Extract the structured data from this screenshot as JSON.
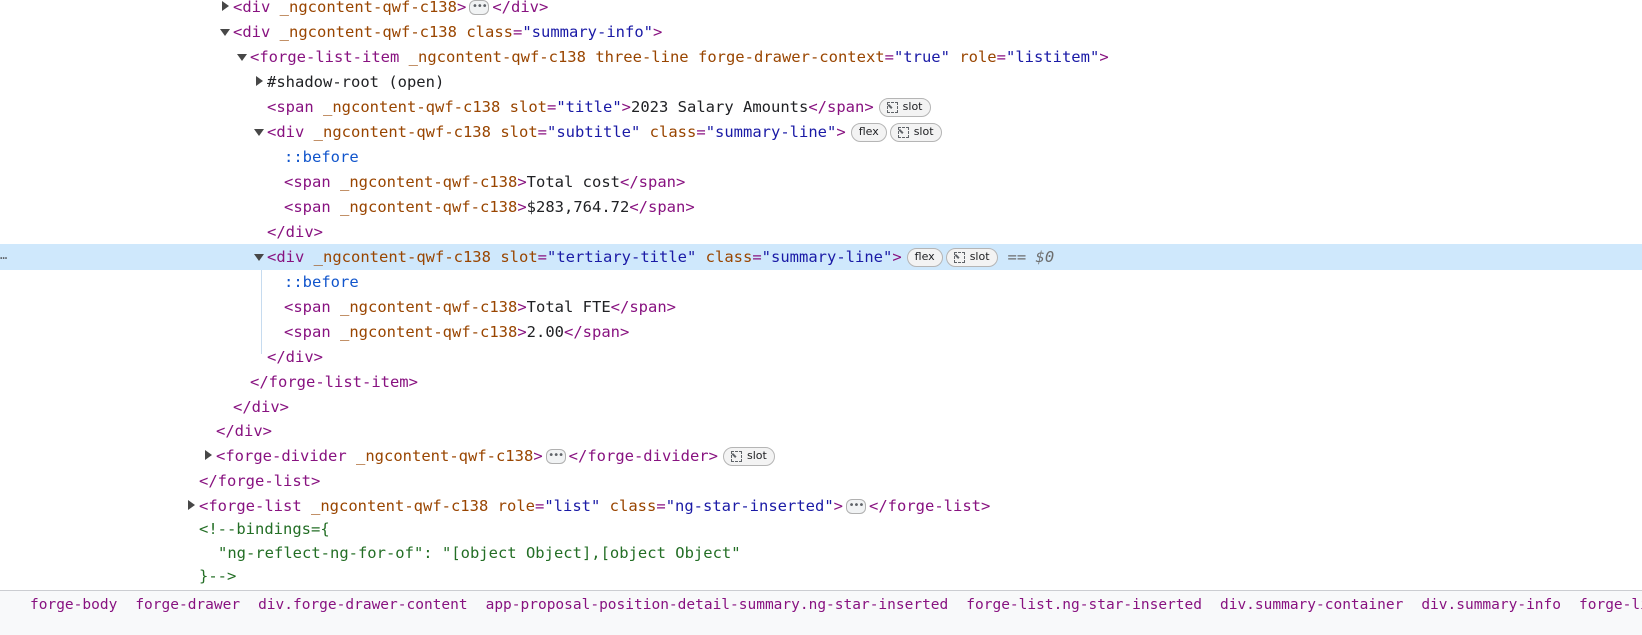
{
  "tree": {
    "r0": {
      "open": "<div",
      "a1": "_ngcontent-qwf-c138",
      "close": ">",
      "endtag": "</div>"
    },
    "r1": {
      "open": "<div",
      "a1": "_ngcontent-qwf-c138",
      "attr": "class",
      "eq": "=",
      "val": "\"summary-info\"",
      "close": ">"
    },
    "r2": {
      "open": "<forge-list-item",
      "a1": "_ngcontent-qwf-c138",
      "a2": "three-line",
      "attr": "forge-drawer-context",
      "eq": "=",
      "val": "\"true\"",
      "attr2": "role",
      "val2": "\"listitem\"",
      "close": ">"
    },
    "r3": {
      "text": "#shadow-root (open)"
    },
    "r4": {
      "open": "<span",
      "a1": "_ngcontent-qwf-c138",
      "attr": "slot",
      "eq": "=",
      "val": "\"title\"",
      "close": ">",
      "text": "2023 Salary Amounts",
      "endtag": "</span>",
      "badge": "slot"
    },
    "r5": {
      "open": "<div",
      "a1": "_ngcontent-qwf-c138",
      "attr": "slot",
      "eq": "=",
      "val": "\"subtitle\"",
      "attr2": "class",
      "val2": "\"summary-line\"",
      "close": ">",
      "badge1": "flex",
      "badge2": "slot"
    },
    "r6": {
      "pseudo": "::before"
    },
    "r7": {
      "open": "<span",
      "a1": "_ngcontent-qwf-c138",
      "close": ">",
      "text": "Total cost",
      "endtag": "</span>"
    },
    "r8": {
      "open": "<span",
      "a1": "_ngcontent-qwf-c138",
      "close": ">",
      "text": "$283,764.72",
      "endtag": "</span>"
    },
    "r9": {
      "endtag": "</div>"
    },
    "r10": {
      "open": "<div",
      "a1": "_ngcontent-qwf-c138",
      "attr": "slot",
      "eq": "=",
      "val": "\"tertiary-title\"",
      "attr2": "class",
      "val2": "\"summary-line\"",
      "close": ">",
      "badge1": "flex",
      "badge2": "slot",
      "eqref": "== $0",
      "gutter": "…"
    },
    "r11": {
      "pseudo": "::before"
    },
    "r12": {
      "open": "<span",
      "a1": "_ngcontent-qwf-c138",
      "close": ">",
      "text": "Total FTE",
      "endtag": "</span>"
    },
    "r13": {
      "open": "<span",
      "a1": "_ngcontent-qwf-c138",
      "close": ">",
      "text": "2.00",
      "endtag": "</span>"
    },
    "r14": {
      "endtag": "</div>"
    },
    "r15": {
      "endtag": "</forge-list-item>"
    },
    "r16": {
      "endtag": "</div>"
    },
    "r17": {
      "endtag": "</div>"
    },
    "r18": {
      "open": "<forge-divider",
      "a1": "_ngcontent-qwf-c138",
      "close": ">",
      "endtag": "</forge-divider>",
      "badge": "slot"
    },
    "r19": {
      "endtag": "</forge-list>"
    },
    "r20": {
      "open": "<forge-list",
      "a1": "_ngcontent-qwf-c138",
      "attr": "role",
      "eq": "=",
      "val": "\"list\"",
      "attr2": "class",
      "val2": "\"ng-star-inserted\"",
      "close": ">",
      "endtag": "</forge-list>"
    },
    "r21": {
      "comment": "<!--bindings={"
    },
    "r22": {
      "comment": "\"ng-reflect-ng-for-of\": \"[object Object],[object Object\""
    },
    "r23": {
      "comment": "}-->"
    }
  },
  "breadcrumb": {
    "items": [
      "forge-body",
      "forge-drawer",
      "div.forge-drawer-content",
      "app-proposal-position-detail-summary.ng-star-inserted",
      "forge-list.ng-star-inserted",
      "div.summary-container",
      "div.summary-info",
      "forge-list-item"
    ]
  },
  "colors": {
    "tag": "#881280",
    "attr": "#994500",
    "value": "#1a1aa6",
    "comment": "#236e25",
    "selected": "#cfe8fc"
  }
}
